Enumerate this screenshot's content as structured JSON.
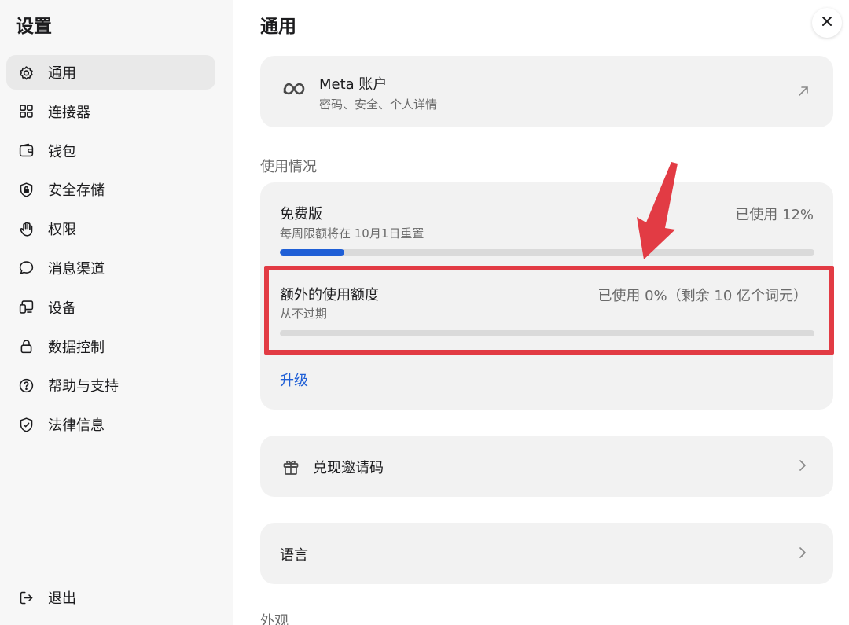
{
  "sidebar": {
    "title": "设置",
    "items": [
      {
        "label": "通用",
        "icon": "gear-icon",
        "active": true
      },
      {
        "label": "连接器",
        "icon": "grid-icon"
      },
      {
        "label": "钱包",
        "icon": "wallet-icon"
      },
      {
        "label": "安全存储",
        "icon": "shield-lock-icon"
      },
      {
        "label": "权限",
        "icon": "hand-icon"
      },
      {
        "label": "消息渠道",
        "icon": "chat-bubble-icon"
      },
      {
        "label": "设备",
        "icon": "devices-icon"
      },
      {
        "label": "数据控制",
        "icon": "lock-icon"
      },
      {
        "label": "帮助与支持",
        "icon": "help-circle-icon"
      },
      {
        "label": "法律信息",
        "icon": "shield-check-icon"
      }
    ],
    "logout_label": "退出"
  },
  "main": {
    "title": "通用",
    "account": {
      "name": "Meta 账户",
      "subtitle": "密码、安全、个人详情"
    },
    "usage_section_label": "使用情况",
    "usage": {
      "plan_name": "免费版",
      "plan_used": "已使用 12%",
      "plan_used_fraction": 0.12,
      "plan_reset": "每周限额将在 10月1日重置",
      "extra_name": "额外的使用额度",
      "extra_used": "已使用 0%（剩余 10 亿个词元）",
      "extra_used_fraction": 0,
      "extra_sub": "从不过期",
      "upgrade_label": "升级"
    },
    "invite_label": "兑现邀请码",
    "language_label": "语言",
    "appearance_section_label": "外观"
  },
  "colors": {
    "accent": "#1f5fd6",
    "highlight": "#e23b44"
  }
}
